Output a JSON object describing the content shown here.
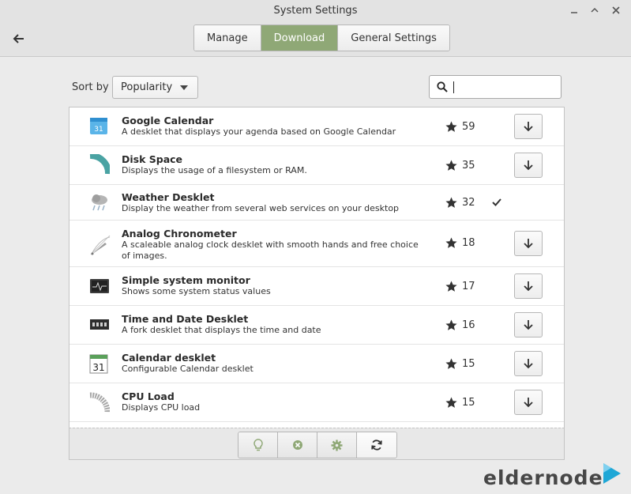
{
  "window": {
    "title": "System Settings",
    "controls": [
      "minimize",
      "maximize",
      "close"
    ]
  },
  "tabs": [
    {
      "label": "Manage",
      "active": false
    },
    {
      "label": "Download",
      "active": true
    },
    {
      "label": "General Settings",
      "active": false
    }
  ],
  "toolbar": {
    "sort_label": "Sort by",
    "sort_value": "Popularity",
    "search_value": "",
    "search_placeholder": ""
  },
  "desklets": [
    {
      "name": "Google Calendar",
      "description": "A desklet that displays your agenda based on Google Calendar",
      "score": "59",
      "installed": false,
      "icon": "google-calendar-icon"
    },
    {
      "name": "Disk Space",
      "description": "Displays the usage of a filesystem or RAM.",
      "score": "35",
      "installed": false,
      "icon": "disk-space-icon"
    },
    {
      "name": "Weather Desklet",
      "description": "Display the weather from several web services on your desktop",
      "score": "32",
      "installed": true,
      "icon": "weather-icon"
    },
    {
      "name": "Analog Chronometer",
      "description": "A scaleable analog clock desklet with smooth hands and free choice of images.",
      "score": "18",
      "installed": false,
      "icon": "analog-clock-icon"
    },
    {
      "name": "Simple system monitor",
      "description": "Shows some system status values",
      "score": "17",
      "installed": false,
      "icon": "system-monitor-icon"
    },
    {
      "name": "Time and Date Desklet",
      "description": "A fork desklet that displays the time and date",
      "score": "16",
      "installed": false,
      "icon": "time-date-icon"
    },
    {
      "name": "Calendar desklet",
      "description": "Configurable Calendar desklet",
      "score": "15",
      "installed": false,
      "icon": "calendar-icon"
    },
    {
      "name": "CPU Load",
      "description": "Displays CPU load",
      "score": "15",
      "installed": false,
      "icon": "cpu-load-icon"
    }
  ],
  "bottom_tools": [
    "info-icon",
    "remove-icon",
    "configure-icon",
    "refresh-icon"
  ],
  "watermark": {
    "text": "eldernode"
  },
  "colors": {
    "accent": "#8fa876",
    "window_bg": "#ebebeb",
    "list_bg": "#ffffff"
  }
}
